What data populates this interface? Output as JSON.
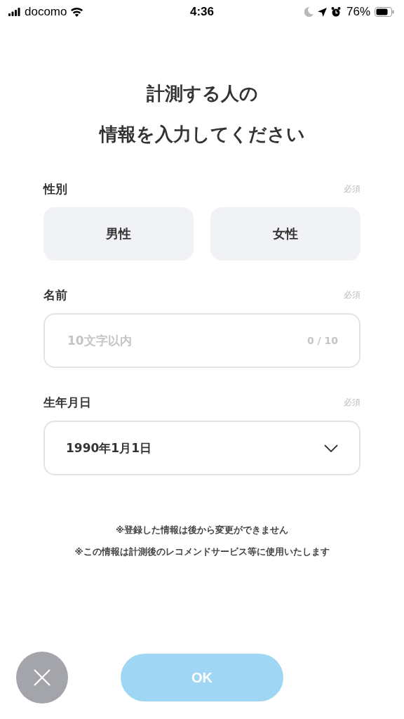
{
  "status_bar": {
    "carrier": "docomo",
    "time": "4:36",
    "battery": "76%"
  },
  "title": [
    "計測する人の",
    "情報を入力してください"
  ],
  "gender": {
    "label": "性別",
    "required": "必須",
    "options": [
      {
        "label": "男性",
        "selected": false
      },
      {
        "label": "女性",
        "selected": false
      }
    ]
  },
  "name": {
    "label": "名前",
    "required": "必須",
    "placeholder": "10文字以内",
    "counter": "0 / 10"
  },
  "birthday": {
    "label": "生年月日",
    "required": "必須",
    "value": "1990年1月1日"
  },
  "notes": [
    "※登録した情報は後から変更ができません",
    "※この情報は計測後のレコメンドサービス等に使用いたします"
  ],
  "ok_button": {
    "label": "OK",
    "disabled": true
  }
}
